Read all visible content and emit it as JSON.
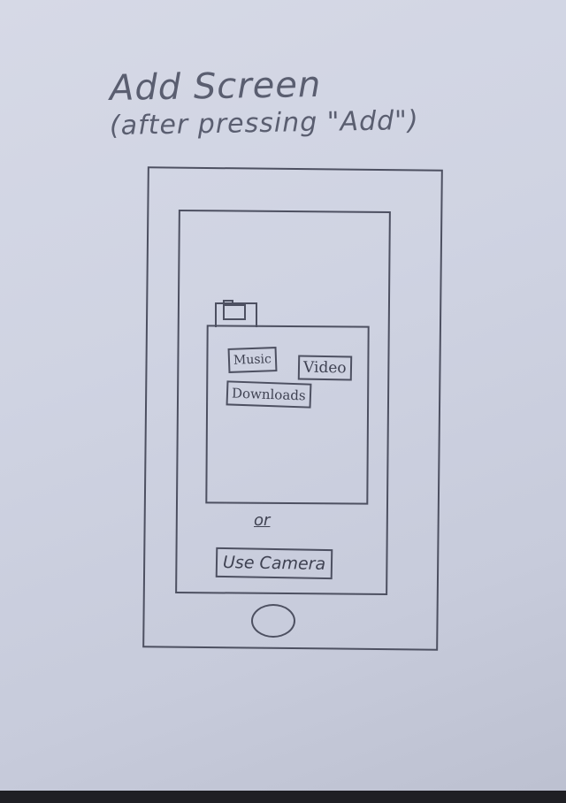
{
  "sketch": {
    "title": "Add Screen",
    "subtitle": "(after pressing \"Add\")"
  },
  "folder": {
    "items": [
      {
        "label": "Music"
      },
      {
        "label": "Video"
      },
      {
        "label": "Downloads"
      }
    ]
  },
  "divider_text": "or",
  "camera_button_label": "Use Camera",
  "icons": {
    "folder": "folder-icon",
    "home": "home-button-icon"
  }
}
